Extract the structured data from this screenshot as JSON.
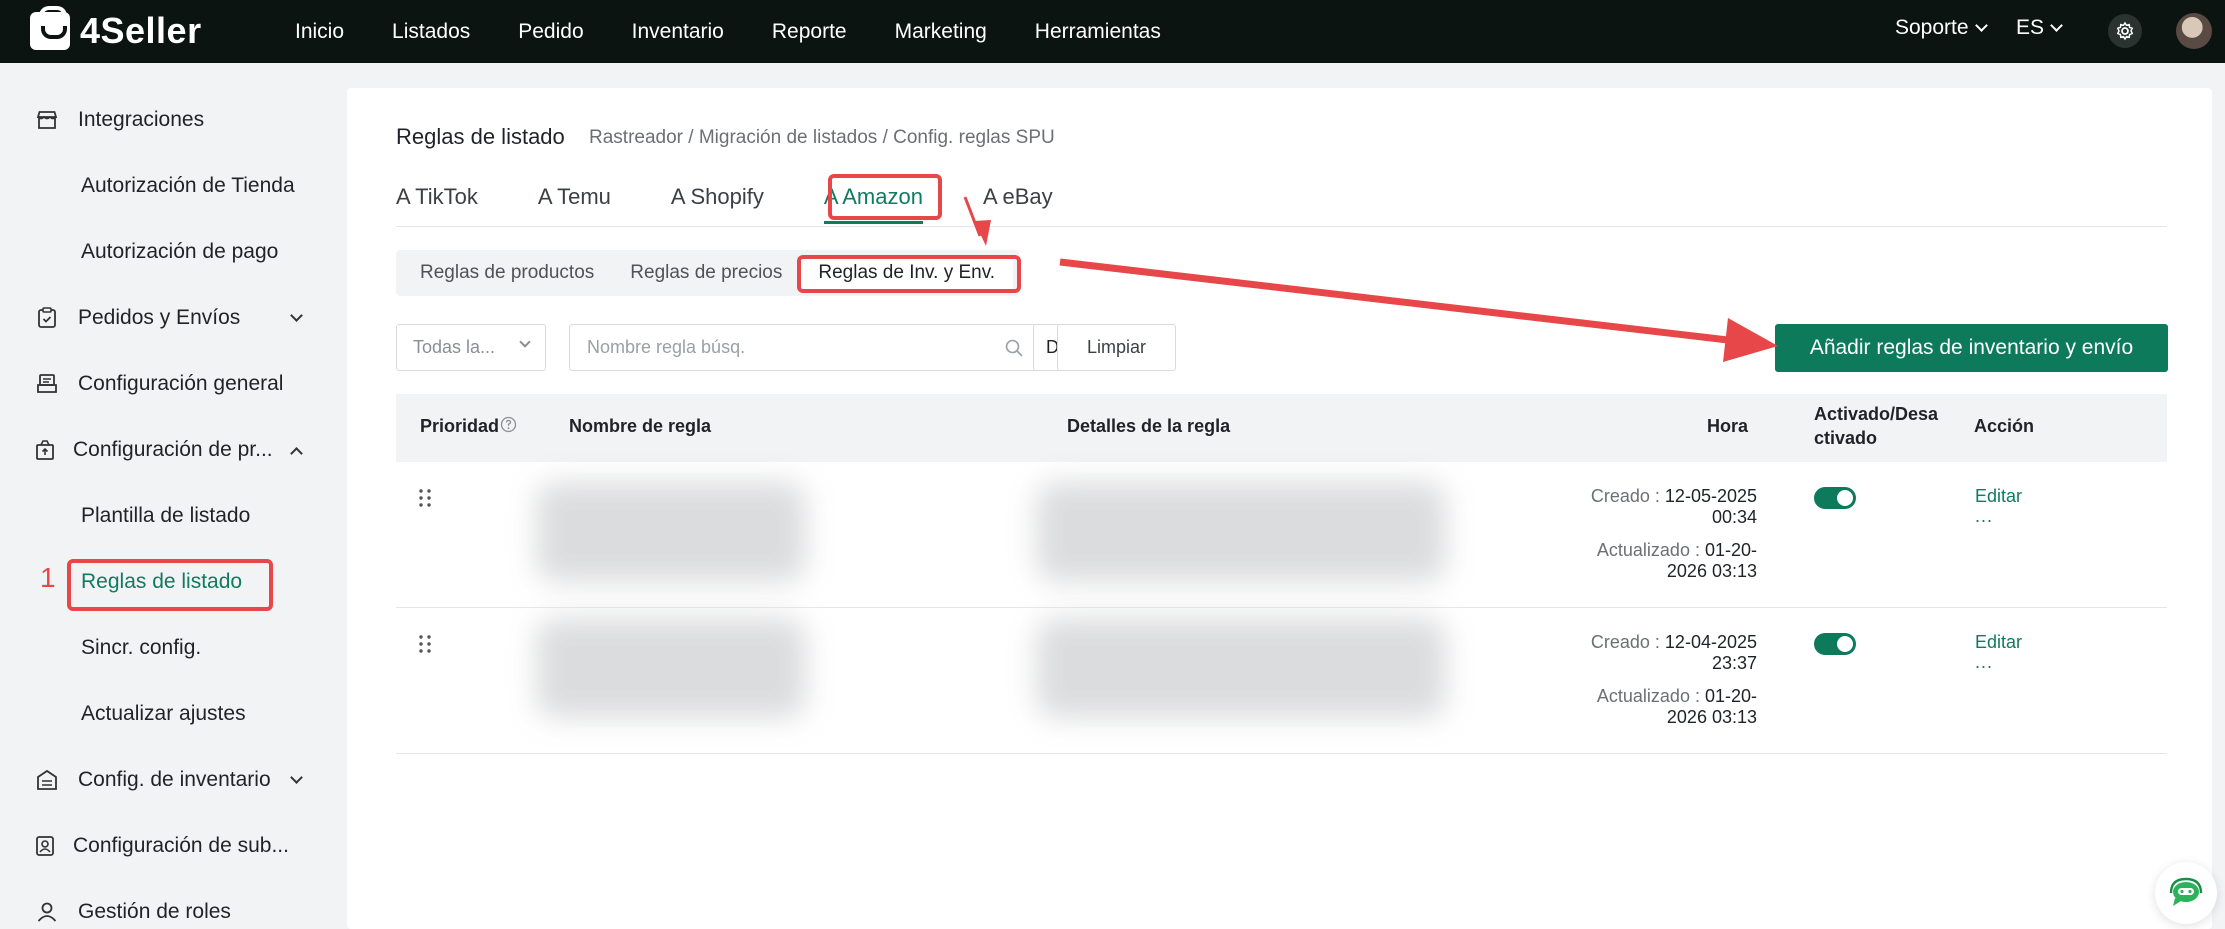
{
  "app": {
    "logo_text": "4Seller"
  },
  "nav": {
    "items": [
      "Inicio",
      "Listados",
      "Pedido",
      "Inventario",
      "Reporte",
      "Marketing",
      "Herramientas"
    ],
    "support": "Soporte",
    "language": "ES"
  },
  "sidebar": {
    "integrations": "Integraciones",
    "store_auth": "Autorización de Tienda",
    "payment_auth": "Autorización de pago",
    "orders_shipping": "Pedidos y Envíos",
    "general_config": "Configuración general",
    "product_config": "Configuración de pr...",
    "listing_template": "Plantilla de listado",
    "listing_rules": "Reglas de listado",
    "sync_config": "Sincr. config.",
    "update_settings": "Actualizar ajustes",
    "inventory_config": "Config. de inventario",
    "sub_config": "Configuración de sub...",
    "role_management": "Gestión de roles",
    "step_number": "1"
  },
  "page": {
    "title": "Reglas de listado",
    "breadcrumb": "Rastreador / Migración de listados / Config. reglas SPU"
  },
  "tabs": [
    "A TikTok",
    "A Temu",
    "A Shopify",
    "A Amazon",
    "A eBay"
  ],
  "subtabs": [
    "Reglas de productos",
    "Reglas de precios",
    "Reglas de Inv. y Env."
  ],
  "filters": {
    "store_select": "Todas la...",
    "search_placeholder": "Nombre regla búsq.",
    "match_mode": "Difuso",
    "clear_button": "Limpiar"
  },
  "primary_button": "Añadir reglas de inventario y envío",
  "table": {
    "headers": {
      "priority": "Prioridad",
      "rule_name": "Nombre de regla",
      "rule_details": "Detalles de la regla",
      "time": "Hora",
      "enabled_line1": "Activado/Desa",
      "enabled_line2": "ctivado",
      "action": "Acción"
    },
    "rows": [
      {
        "created_label": "Creado :",
        "created_date": "12-05-2025",
        "created_time": "00:34",
        "updated_label": "Actualizado :",
        "updated_date": "01-20-",
        "updated_time": "2026 03:13",
        "enabled": true,
        "edit": "Editar",
        "more": "..."
      },
      {
        "created_label": "Creado :",
        "created_date": "12-04-2025",
        "created_time": "23:37",
        "updated_label": "Actualizado :",
        "updated_date": "01-20-",
        "updated_time": "2026 03:13",
        "enabled": true,
        "edit": "Editar",
        "more": "..."
      }
    ]
  },
  "colors": {
    "accent": "#0d7a5c",
    "highlight": "#e84749",
    "nav_bg": "#0b1411"
  },
  "icons": [
    "gear-icon",
    "avatar",
    "search-icon",
    "drag-handle-icon",
    "chat-support-icon",
    "help-circle-icon"
  ]
}
